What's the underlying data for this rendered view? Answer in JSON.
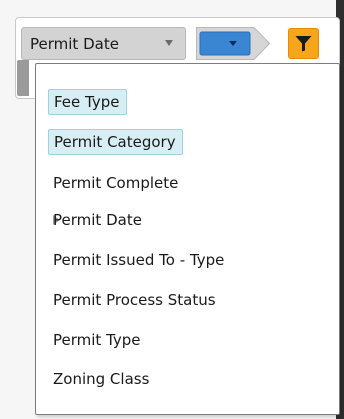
{
  "filter_bar": {
    "field_select": {
      "selected": "Permit Date",
      "caret_icon": "chevron-down-icon"
    },
    "value_select": {
      "selected": "",
      "caret_icon": "chevron-down-icon",
      "fill_color": "#3b86d3"
    },
    "filter_button": {
      "icon": "filter-icon",
      "color": "#f7a51a"
    }
  },
  "menu": {
    "items": [
      {
        "label": "Fee Type",
        "highlighted": true,
        "has_submenu": false
      },
      {
        "label": "Permit Category",
        "highlighted": true,
        "has_submenu": false
      },
      {
        "label": "Permit Complete",
        "highlighted": false,
        "has_submenu": false
      },
      {
        "label": "Permit Date",
        "highlighted": false,
        "has_submenu": true
      },
      {
        "label": "Permit Issued To - Type",
        "highlighted": false,
        "has_submenu": false
      },
      {
        "label": "Permit Process Status",
        "highlighted": false,
        "has_submenu": false
      },
      {
        "label": "Permit Type",
        "highlighted": false,
        "has_submenu": false
      },
      {
        "label": "Zoning Class",
        "highlighted": false,
        "has_submenu": false
      }
    ]
  },
  "colors": {
    "highlight_bg": "#d6eef4",
    "highlight_border": "#9fd2df",
    "menu_border": "#7d7d7d"
  }
}
